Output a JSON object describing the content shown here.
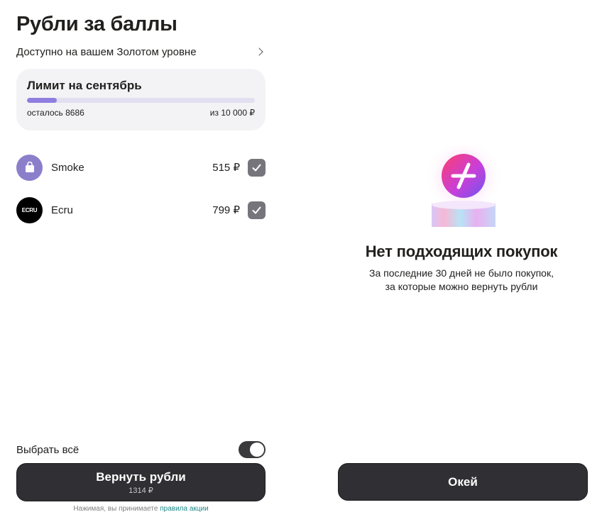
{
  "left": {
    "title": "Рубли за баллы",
    "level_text": "Доступно на вашем Золотом уровне",
    "limit": {
      "title": "Лимит на сентябрь",
      "remaining_text": "осталось 8686",
      "total_text": "из 10 000 ₽",
      "progress": 0.13
    },
    "purchases": [
      {
        "name": "Smoke",
        "price": "515 ₽",
        "icon": "shopping-bag-icon",
        "checked": true
      },
      {
        "name": "Ecru",
        "price": "799 ₽",
        "logo_text": "ECRU",
        "checked": true
      }
    ],
    "select_all_label": "Выбрать всё",
    "select_all_on": true,
    "return_button": {
      "label": "Вернуть рубли",
      "sub": "1314 ₽"
    },
    "terms_prefix": "Нажимая, вы принимаете ",
    "terms_link": "правила акции"
  },
  "right": {
    "empty_title": "Нет подходящих покупок",
    "empty_desc_line1": "За последние 30 дней не было покупок,",
    "empty_desc_line2": "за которые можно вернуть рубли",
    "ok_button": "Окей"
  },
  "colors": {
    "accent": "#8f7ee0",
    "button": "#302f33",
    "link": "#1e8a8a",
    "card": "#f3f3f5"
  }
}
